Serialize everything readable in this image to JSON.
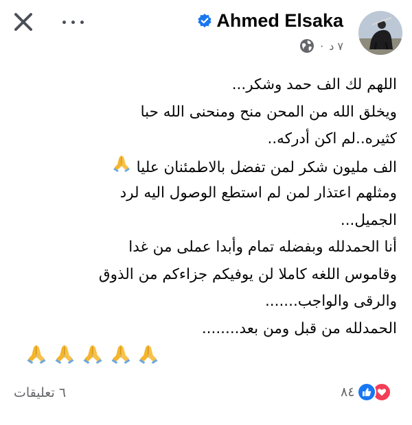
{
  "header": {
    "close_icon": "close-icon",
    "more_icon": "more-options-icon",
    "author_name": "Ahmed Elsaka",
    "verified_icon": "verified-badge-icon",
    "time": "٧ د",
    "separator": "·",
    "privacy_icon": "public-globe-icon",
    "avatar_icon": "profile-avatar"
  },
  "post": {
    "lines": [
      "اللهم لك الف حمد وشكر...",
      "ويخلق الله من المحن منح ومنحنى الله حبا",
      "كثيره..لم اكن أدركه..",
      "الف مليون شكر لمن تفضل بالاطمئنان عليا",
      "ومثلهم اعتذار لمن لم استطع الوصول اليه لرد",
      "الجميل...",
      "أنا الحمدلله وبفضله تمام وأبدا عملى من غدا",
      "وقاموس اللغه كاملا لن يوفيكم جزاءكم من الذوق",
      "والرقى والواجب.......",
      "الحمدلله من قبل ومن بعد........"
    ],
    "emoji_icon": "folded-hands-emoji"
  },
  "footer": {
    "reaction_count": "٨٤",
    "like_icon": "like-reaction-icon",
    "love_icon": "love-reaction-icon",
    "comments_label": "٦ تعليقات"
  },
  "colors": {
    "text": "#050505",
    "secondary": "#65676b",
    "facebook_blue": "#1877f2",
    "love_red": "#f33e58",
    "emoji_yellow": "#f5b52b"
  }
}
